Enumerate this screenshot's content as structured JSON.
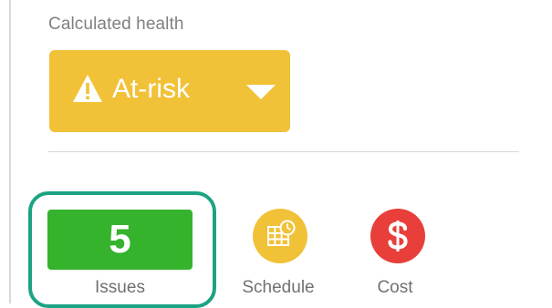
{
  "health": {
    "label": "Calculated health",
    "value": "At-risk",
    "color": "#f1c137",
    "icons": [
      "warning-triangle-icon",
      "caret-down-icon"
    ]
  },
  "metrics": [
    {
      "id": "issues",
      "count": "5",
      "caption": "Issues",
      "color": "#36b32d",
      "focused": true,
      "focus_color": "#1ca383"
    },
    {
      "id": "schedule",
      "caption": "Schedule",
      "icon": "calendar-clock-icon",
      "color": "#f1c137"
    },
    {
      "id": "cost",
      "caption": "Cost",
      "icon": "dollar-icon",
      "color": "#e83f3a"
    }
  ]
}
